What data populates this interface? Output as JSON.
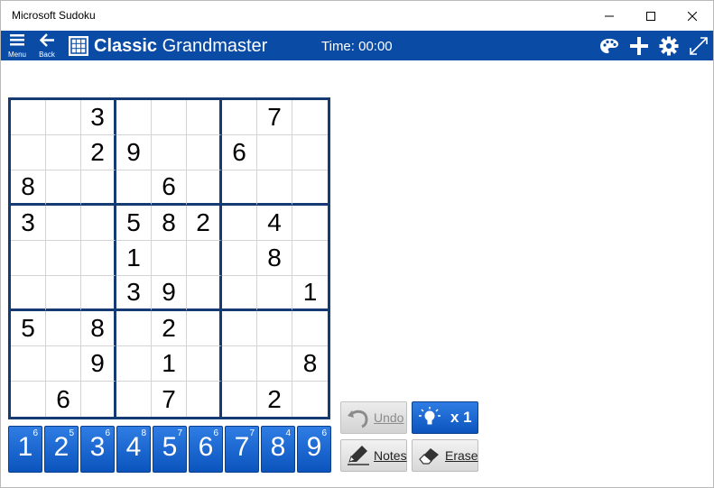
{
  "window": {
    "title": "Microsoft Sudoku"
  },
  "appbar": {
    "menu_label": "Menu",
    "back_label": "Back",
    "game_mode": "Classic",
    "difficulty": "Grandmaster",
    "timer": "Time: 00:00",
    "background_color": "#0a4ba6"
  },
  "board": {
    "rows": [
      [
        "",
        "",
        "3",
        "",
        "",
        "",
        "",
        "7",
        ""
      ],
      [
        "",
        "",
        "2",
        "9",
        "",
        "",
        "6",
        "",
        ""
      ],
      [
        "8",
        "",
        "",
        "",
        "6",
        "",
        "",
        "",
        ""
      ],
      [
        "3",
        "",
        "",
        "5",
        "8",
        "2",
        "",
        "4",
        ""
      ],
      [
        "",
        "",
        "",
        "1",
        "",
        "",
        "",
        "8",
        ""
      ],
      [
        "",
        "",
        "",
        "3",
        "9",
        "",
        "",
        "",
        "1"
      ],
      [
        "5",
        "",
        "8",
        "",
        "2",
        "",
        "",
        "",
        ""
      ],
      [
        "",
        "",
        "9",
        "",
        "1",
        "",
        "",
        "",
        "8"
      ],
      [
        "",
        "6",
        "",
        "",
        "7",
        "",
        "",
        "2",
        ""
      ]
    ]
  },
  "numpad": [
    {
      "digit": "1",
      "remaining": "6"
    },
    {
      "digit": "2",
      "remaining": "5"
    },
    {
      "digit": "3",
      "remaining": "6"
    },
    {
      "digit": "4",
      "remaining": "8"
    },
    {
      "digit": "5",
      "remaining": "7"
    },
    {
      "digit": "6",
      "remaining": "6"
    },
    {
      "digit": "7",
      "remaining": "7"
    },
    {
      "digit": "8",
      "remaining": "4"
    },
    {
      "digit": "9",
      "remaining": "6"
    }
  ],
  "actions": {
    "undo_label": "Undo",
    "hint_count": "x 1",
    "notes_label": "Notes",
    "erase_label": "Erase"
  },
  "icons": [
    "minimize-icon",
    "maximize-icon",
    "close-icon",
    "menu-icon",
    "back-arrow-icon",
    "grid-logo-icon",
    "palette-icon",
    "plus-icon",
    "gear-icon",
    "expand-icon",
    "undo-icon",
    "lightbulb-icon",
    "pencil-icon",
    "eraser-icon"
  ]
}
